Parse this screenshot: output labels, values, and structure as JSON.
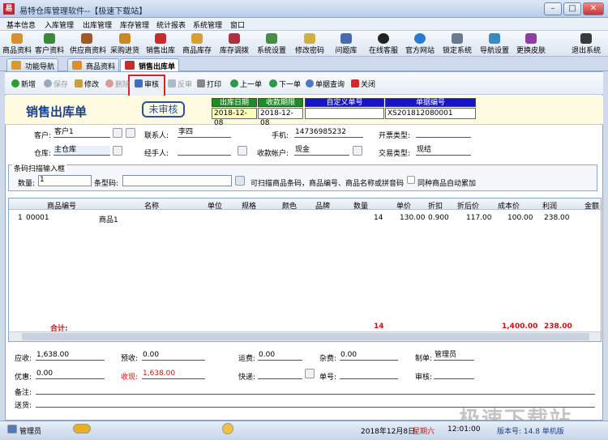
{
  "window": {
    "title": "易特仓库管理软件--【极速下载站】",
    "icon": "易"
  },
  "menu": [
    "基本信息",
    "入库管理",
    "出库管理",
    "库存管理",
    "统计报表",
    "系统管理",
    "窗口"
  ],
  "toolbar": [
    "商品资料",
    "客户资料",
    "供应商资料",
    "采购进货",
    "销售出库",
    "商品库存",
    "库存调拨",
    "系统设置",
    "修改密码",
    "问题库",
    "在线客服",
    "官方网站",
    "锁定系统",
    "导航设置",
    "更换皮肤",
    "退出系统"
  ],
  "tabs": [
    "功能导航",
    "商品资料",
    "销售出库单"
  ],
  "actions": {
    "add": "新增",
    "save": "保存",
    "edit": "修改",
    "delete": "删除",
    "approve": "审核",
    "unapprove": "反审",
    "print": "打印",
    "prev": "上一单",
    "next": "下一单",
    "query": "单据查询",
    "close": "关闭"
  },
  "doc": {
    "title": "销售出库单",
    "stamp": "未审核",
    "header_labels": [
      "出库日期",
      "收款期限",
      "自定义单号",
      "单据编号"
    ],
    "header_values": [
      "2018-12-08",
      "2018-12-08",
      "",
      "XS201812080001"
    ]
  },
  "form": {
    "customer_label": "客户:",
    "customer": "客户1",
    "contact_label": "联系人:",
    "contact": "李四",
    "phone_label": "手机:",
    "phone": "14736985232",
    "invoice_label": "开票类型:",
    "invoice": "",
    "warehouse_label": "仓库:",
    "warehouse": "主仓库",
    "handler_label": "经手人:",
    "handler": "",
    "account_label": "收款帐户:",
    "account": "现金",
    "trade_label": "交易类型:",
    "trade": "现结"
  },
  "scan": {
    "title": "条码扫描输入框",
    "qty_label": "数量:",
    "qty": "1",
    "barcode_label": "条型码:",
    "barcode": "",
    "hint": "可扫描商品条码，商品编号、商品名称或拼音码",
    "accum_label": "同种商品自动累加"
  },
  "grid": {
    "columns": [
      "商品编号",
      "名称",
      "单位",
      "规格",
      "颜色",
      "品牌",
      "数量",
      "单价",
      "折扣",
      "折后价",
      "成本价",
      "利润",
      "金额"
    ],
    "rows": [
      {
        "no": "1",
        "code": "00001",
        "name": "商品1",
        "unit": "",
        "spec": "",
        "color": "",
        "brand": "",
        "qty": "14",
        "price": "130.00",
        "discount": "0.900",
        "after": "117.00",
        "cost": "100.00",
        "profit": "238.00"
      }
    ],
    "total_label": "合计:",
    "total_qty": "14",
    "total_cost": "1,400.00",
    "total_profit": "238.00"
  },
  "footer": {
    "receivable_label": "应收:",
    "receivable": "1,638.00",
    "prepaid_label": "预收:",
    "prepaid": "0.00",
    "freight_label": "运费:",
    "freight": "0.00",
    "misc_label": "杂费:",
    "misc": "0.00",
    "maker_label": "制单:",
    "maker": "管理员",
    "discount_label": "优惠:",
    "discount": "0.00",
    "cash_label": "收现:",
    "cash": "1,638.00",
    "express_label": "快递:",
    "express": "",
    "tracking_label": "单号:",
    "tracking": "",
    "auditor_label": "审核:",
    "auditor": "",
    "remark_label": "备注:",
    "remark": "",
    "shipto_label": "送货:",
    "shipto": ""
  },
  "status": {
    "user": "管理员",
    "date": "2018年12月8日",
    "weekday": "星期六",
    "time": "12:01:00",
    "version": "版本号: 14.8 单机版"
  },
  "watermark": "极速下载站"
}
